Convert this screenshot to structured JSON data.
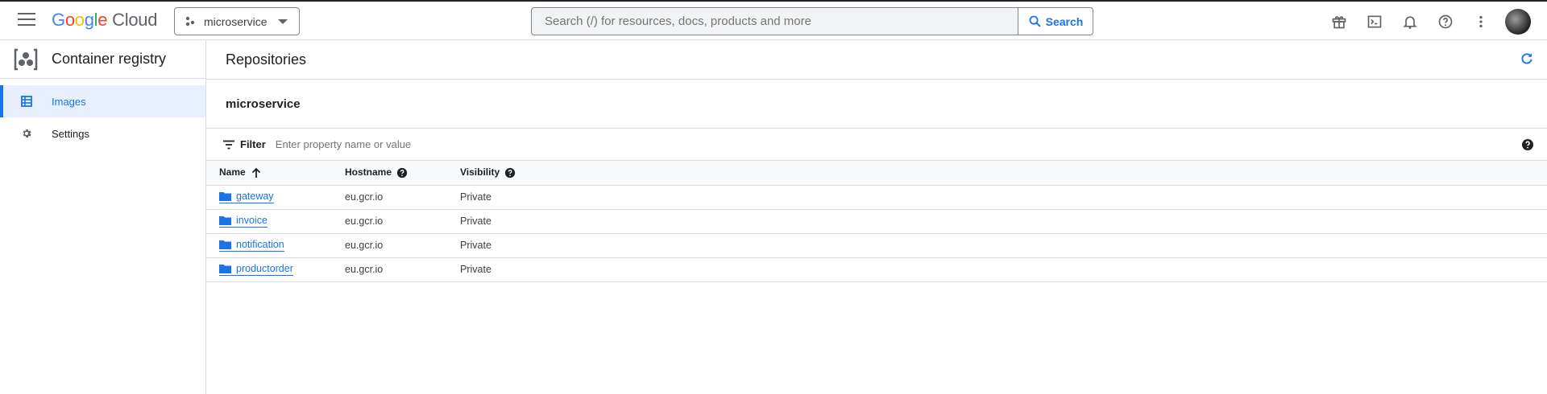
{
  "header": {
    "logo_google": [
      "G",
      "o",
      "o",
      "g",
      "l",
      "e"
    ],
    "logo_cloud": "Cloud",
    "project_name": "microservice",
    "search_placeholder": "Search (/) for resources, docs, products and more",
    "search_button": "Search",
    "icons": [
      "gift-icon",
      "terminal-icon",
      "bell-icon",
      "help-icon",
      "more-vert-icon"
    ]
  },
  "sidebar": {
    "title": "Container registry",
    "items": [
      {
        "label": "Images",
        "icon": "table-icon",
        "active": true
      },
      {
        "label": "Settings",
        "icon": "gear-icon",
        "active": false
      }
    ]
  },
  "main": {
    "title": "Repositories",
    "section": "microservice",
    "filter_label": "Filter",
    "filter_placeholder": "Enter property name or value",
    "columns": [
      "Name",
      "Hostname",
      "Visibility"
    ],
    "rows": [
      {
        "name": "gateway",
        "hostname": "eu.gcr.io",
        "visibility": "Private"
      },
      {
        "name": "invoice",
        "hostname": "eu.gcr.io",
        "visibility": "Private"
      },
      {
        "name": "notification",
        "hostname": "eu.gcr.io",
        "visibility": "Private"
      },
      {
        "name": "productorder",
        "hostname": "eu.gcr.io",
        "visibility": "Private"
      }
    ]
  },
  "colors": {
    "accent": "#1a73e8",
    "border": "#dadce0"
  }
}
